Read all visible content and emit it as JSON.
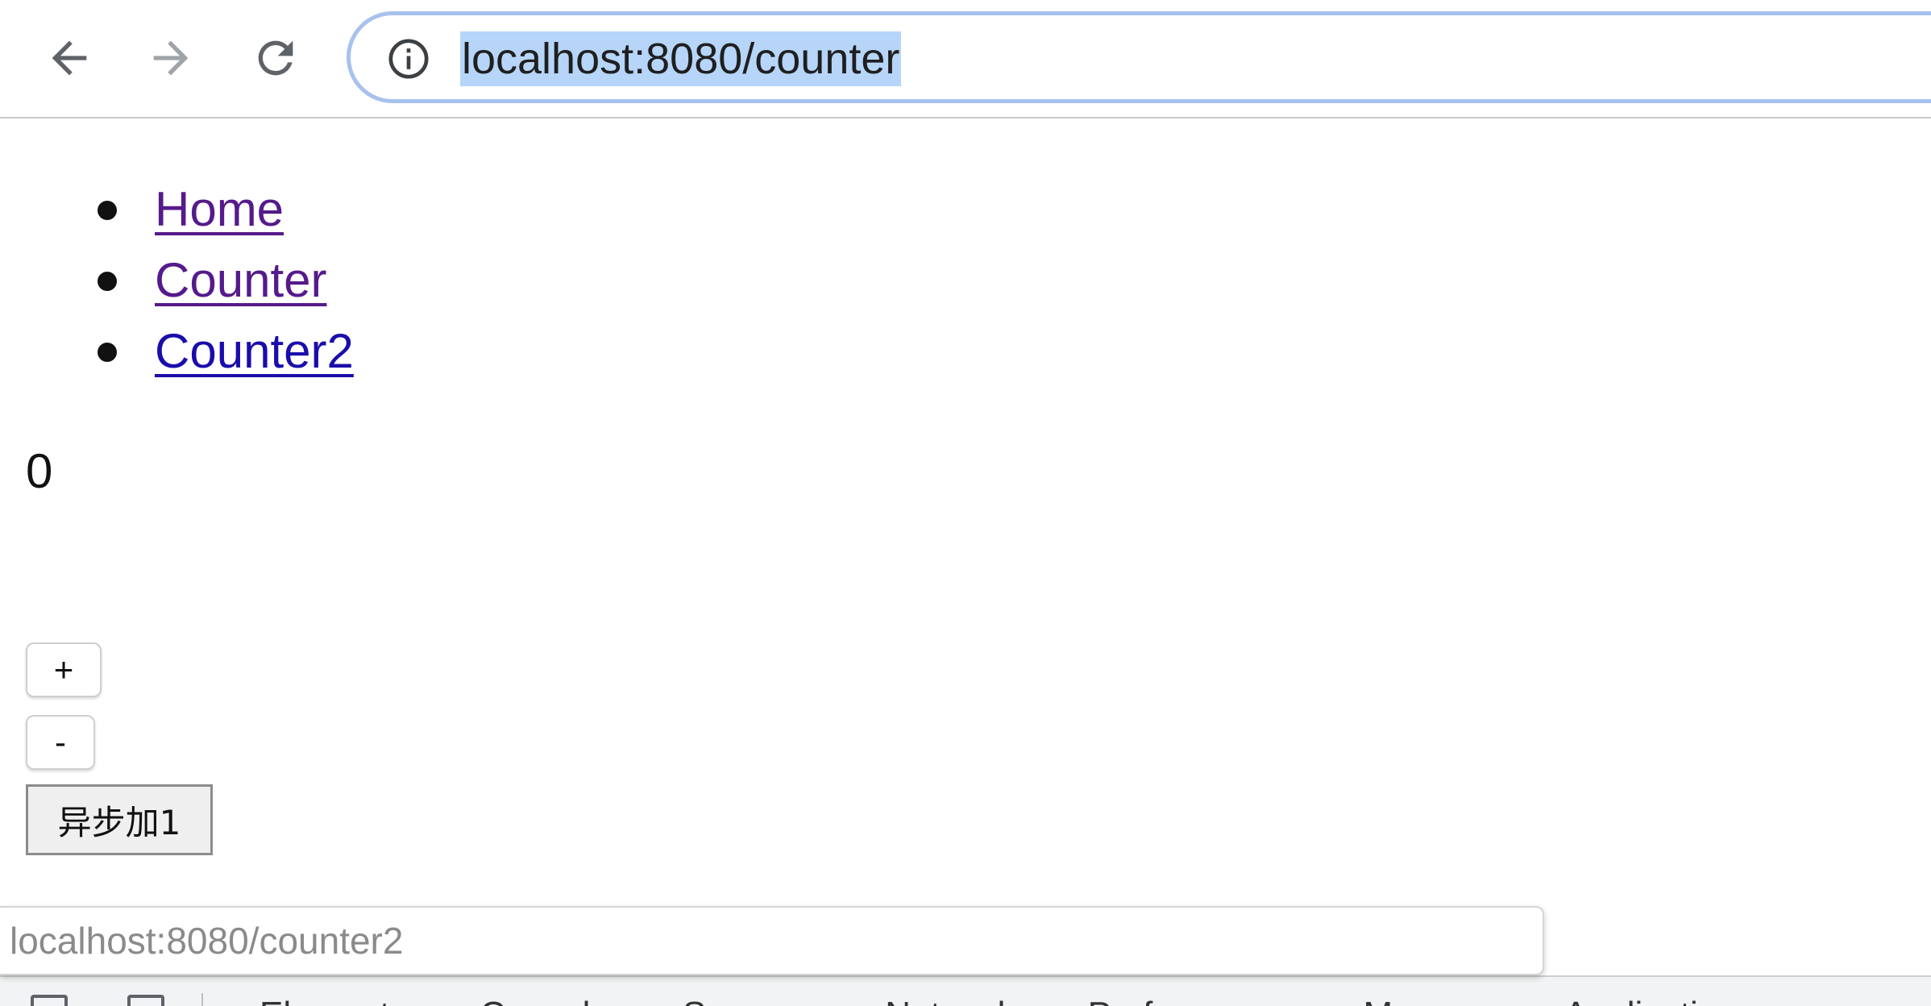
{
  "browser": {
    "url": "localhost:8080/counter",
    "back_icon": "arrow-left-icon",
    "forward_icon": "arrow-right-icon",
    "reload_icon": "reload-icon",
    "info_icon": "info-icon"
  },
  "nav": {
    "links": [
      {
        "label": "Home",
        "visited": true
      },
      {
        "label": "Counter",
        "visited": true
      },
      {
        "label": "Counter2",
        "visited": false
      }
    ]
  },
  "counter": {
    "value": "0",
    "plus_label": "+",
    "minus_label": "-",
    "async_label": "异步加1"
  },
  "status_bar": {
    "text": "localhost:8080/counter2"
  },
  "devtools": {
    "tabs": [
      "Elements",
      "Console",
      "Sources",
      "Network",
      "Performance",
      "Memory",
      "Application"
    ]
  },
  "colors": {
    "visited_link": "#551a8b",
    "unvisited_link": "#1a0dab",
    "url_selection": "#b6d5f9",
    "omnibox_focus": "#a8c1ee"
  }
}
